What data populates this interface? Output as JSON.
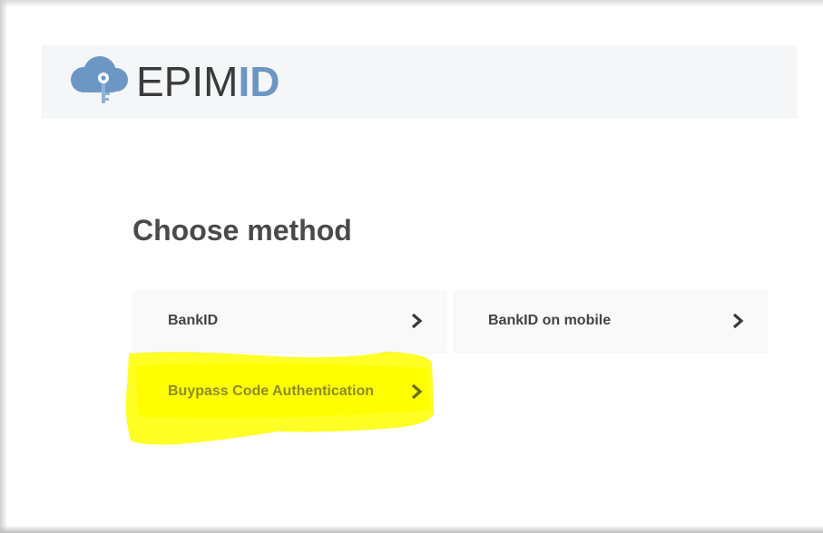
{
  "header": {
    "logo": {
      "icon": "cloud-key-icon",
      "text_regular": "EPIM",
      "text_bold": "ID",
      "brand_color": "#6c97c4"
    }
  },
  "main": {
    "title": "Choose method",
    "methods": [
      {
        "label": "BankID",
        "icon": "chevron-right-icon"
      },
      {
        "label": "BankID on mobile",
        "icon": "chevron-right-icon"
      },
      {
        "label": "Buypass Code Authentication",
        "icon": "chevron-right-icon",
        "highlighted": true
      }
    ]
  },
  "colors": {
    "header_bg": "#f5f6f8",
    "tile_bg": "#f9f9f9",
    "highlight": "#ffff00"
  }
}
